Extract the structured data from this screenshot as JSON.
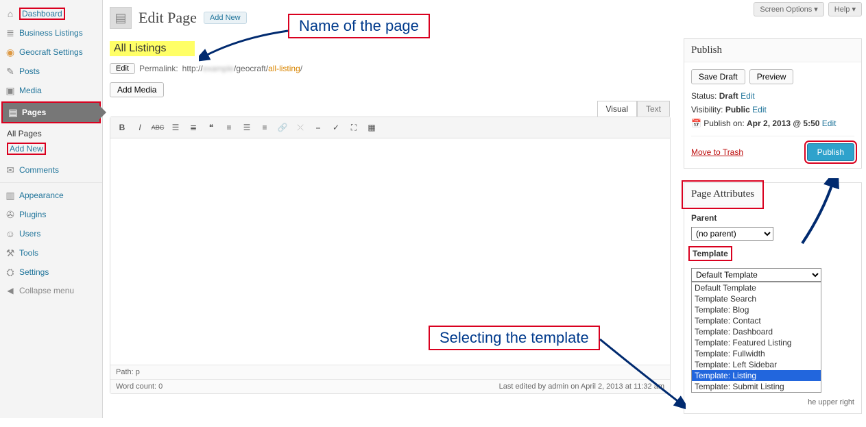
{
  "topbar": {
    "screen_options": "Screen Options ▾",
    "help": "Help ▾"
  },
  "sidebar": {
    "items": [
      {
        "icon": "⌂",
        "label": "Dashboard"
      },
      {
        "icon": "≣",
        "label": "Business Listings"
      },
      {
        "icon": "◉",
        "label": "Geocraft Settings"
      },
      {
        "icon": "✎",
        "label": "Posts"
      },
      {
        "icon": "▣",
        "label": "Media"
      },
      {
        "icon": "▤",
        "label": "Pages"
      },
      {
        "icon": "✉",
        "label": "Comments"
      },
      {
        "icon": "▥",
        "label": "Appearance"
      },
      {
        "icon": "✇",
        "label": "Plugins"
      },
      {
        "icon": "☺",
        "label": "Users"
      },
      {
        "icon": "⚒",
        "label": "Tools"
      },
      {
        "icon": "⛭",
        "label": "Settings"
      }
    ],
    "sub_pages": {
      "all": "All Pages",
      "add_new": "Add New"
    },
    "collapse": "Collapse menu"
  },
  "header": {
    "title": "Edit Page",
    "add_new": "Add New"
  },
  "title_input": "All Listings",
  "permalink": {
    "edit": "Edit",
    "label": "Permalink:",
    "prefix": "http://",
    "mid": "/geocraft/",
    "slug": "all-listing",
    "suffix": "/"
  },
  "media_button": "Add Media",
  "editor_tabs": {
    "visual": "Visual",
    "text": "Text"
  },
  "editor": {
    "path_label": "Path:",
    "path_value": "p",
    "word_count_label": "Word count:",
    "word_count": "0",
    "last_edited": "Last edited by admin on April 2, 2013 at 11:32 am"
  },
  "publish": {
    "heading": "Publish",
    "save_draft": "Save Draft",
    "preview": "Preview",
    "status_label": "Status:",
    "status": "Draft",
    "status_edit": "Edit",
    "vis_label": "Visibility:",
    "vis": "Public",
    "vis_edit": "Edit",
    "sched_label": "Publish on:",
    "sched": "Apr 2, 2013 @ 5:50",
    "sched_edit": "Edit",
    "trash": "Move to Trash",
    "button": "Publish"
  },
  "page_attr": {
    "heading": "Page Attributes",
    "parent_label": "Parent",
    "parent_value": "(no parent)",
    "template_label": "Template",
    "template_value": "Default Template",
    "options": [
      "Default Template",
      "Template Search",
      "Template: Blog",
      "Template: Contact",
      "Template: Dashboard",
      "Template: Featured Listing",
      "Template: Fullwidth",
      "Template: Left Sidebar",
      "Template: Listing",
      "Template: Submit Listing"
    ],
    "selected_index": 8,
    "hint": "he upper right"
  },
  "annotations": {
    "name_of_page": "Name of the page",
    "selecting_template": "Selecting the template"
  }
}
